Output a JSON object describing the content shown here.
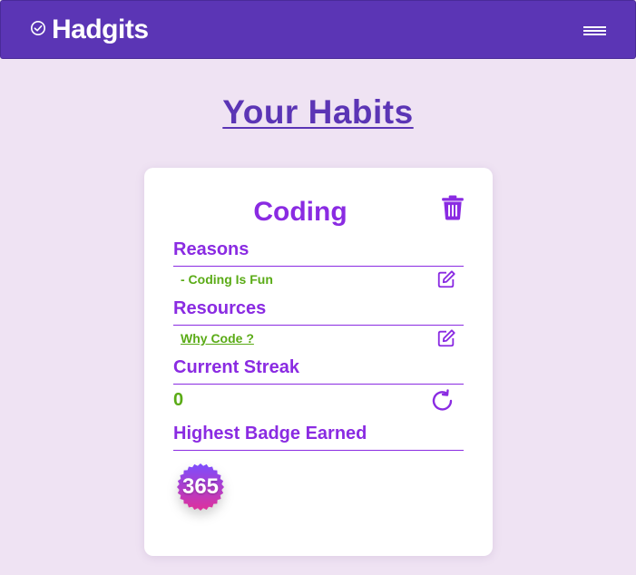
{
  "navbar": {
    "brand": "Hadgits",
    "brand_icon": "check-circle-icon",
    "menu_icon": "hamburger-menu-icon",
    "color": "#5b35b5"
  },
  "page": {
    "title": "Your Habits",
    "background": "#efe3f3"
  },
  "habit": {
    "name": "Coding",
    "delete_icon": "trash-icon",
    "reasons_heading": "Reasons",
    "reasons": [
      "- Coding Is Fun"
    ],
    "resources_heading": "Resources",
    "resources": [
      "Why Code ?"
    ],
    "streak_heading": "Current Streak",
    "streak_value": "0",
    "reset_icon": "refresh-icon",
    "badge_heading": "Highest Badge Earned",
    "badge_value": "365",
    "accent_color": "#8a2be2",
    "value_color": "#5aab16"
  }
}
